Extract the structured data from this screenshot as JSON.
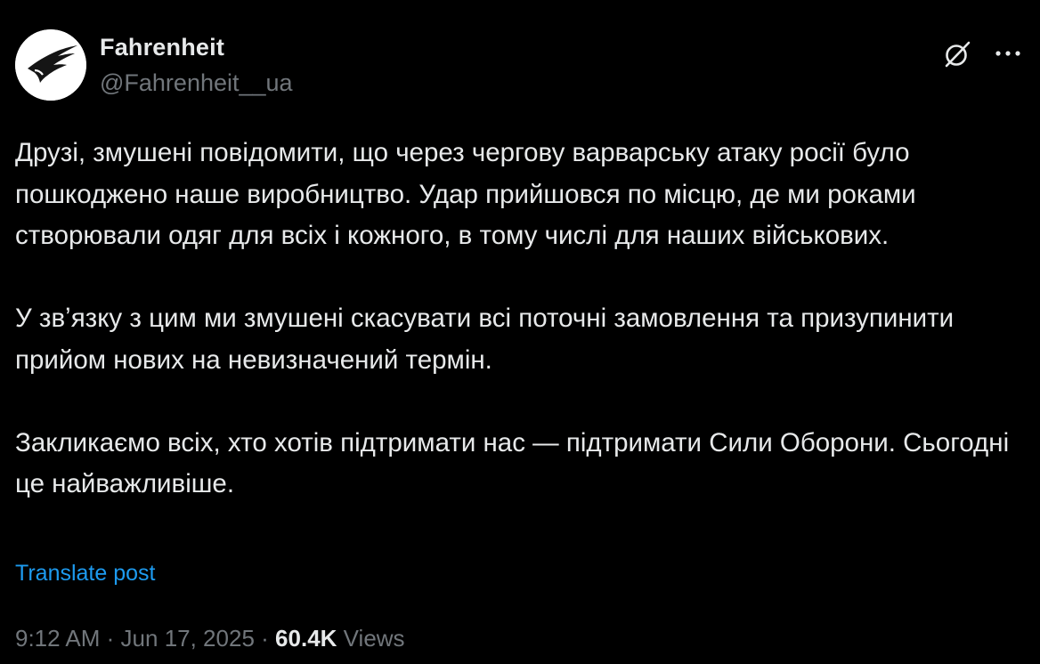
{
  "author": {
    "display_name": "Fahrenheit",
    "handle": "@Fahrenheit__ua"
  },
  "icons": {
    "avatar": "fahrenheit-logo",
    "grok": "grok-icon",
    "more": "more-dots-icon"
  },
  "post": {
    "paragraphs": [
      "Друзі, змушені повідомити, що через чергову варварську атаку росії було пошкоджено наше виробництво. Удар прийшовся по місцю, де ми роками створювали одяг для всіх і кожного, в тому числі для наших військових.",
      "У звʼязку з цим ми змушені скасувати всі поточні замовлення та призупинити прийом нових на невизначений термін.",
      "Закликаємо всіх, хто хотів підтримати нас — підтримати Сили Оборони. Сьогодні це найважливіше."
    ],
    "translate_label": "Translate post"
  },
  "meta": {
    "time": "9:12 AM",
    "separator": "·",
    "date": "Jun 17, 2025",
    "views_count": "60.4K",
    "views_label": "Views"
  },
  "colors": {
    "background": "#000000",
    "text": "#e7e9ea",
    "secondary": "#71767b",
    "link": "#1d9bf0"
  }
}
